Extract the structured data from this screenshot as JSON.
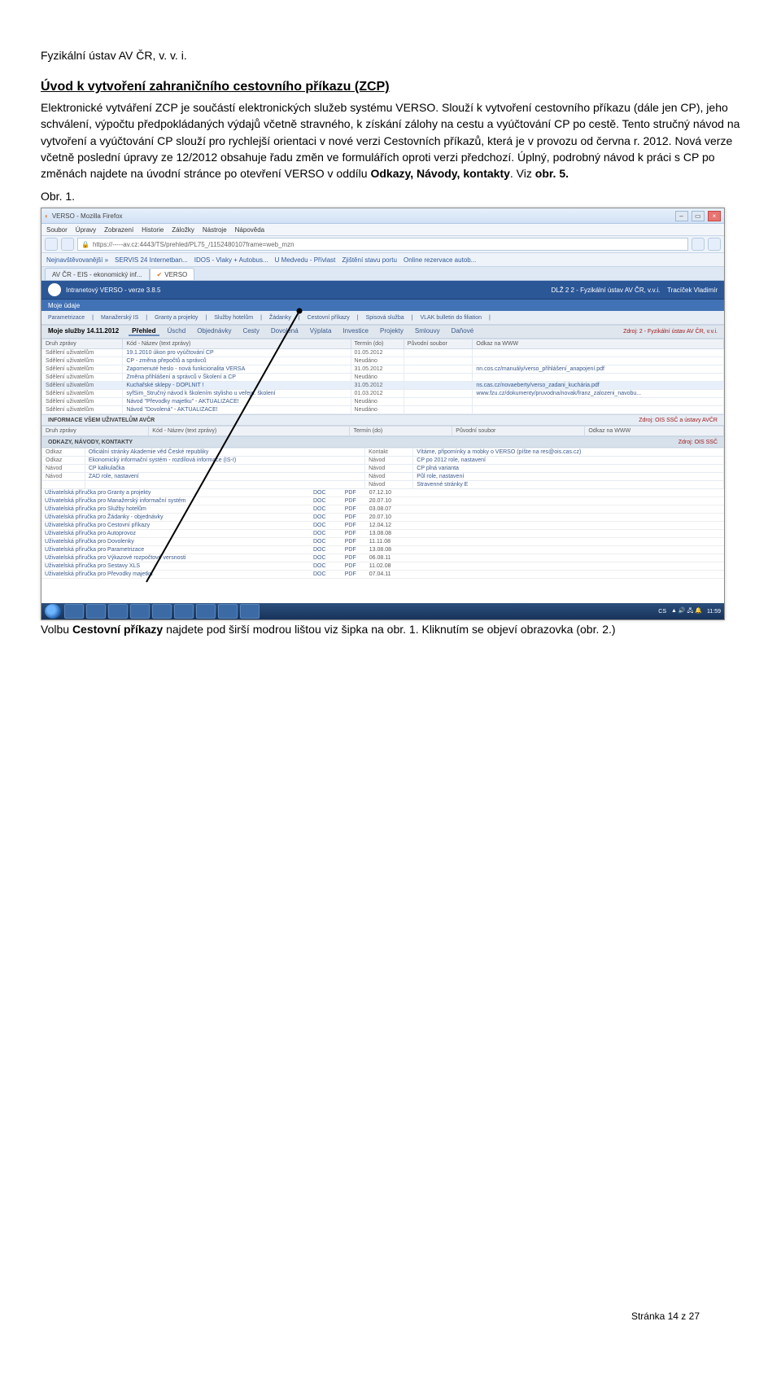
{
  "doc": {
    "header": "Fyzikální ústav AV ČR, v. v. i.",
    "title": "Úvod k vytvoření zahraničního cestovního příkazu (ZCP)",
    "p1a": "Elektronické vytváření ZCP je součástí elektronických služeb systému VERSO. Slouží k vytvoření cestovního příkazu (dále jen CP), jeho schválení, výpočtu předpokládaných výdajů včetně stravného, k získání zálohy na cestu a vyúčtování CP po cestě. Tento stručný návod na vytvoření a vyúčtování CP slouží pro rychlejší orientaci v nové verzi Cestovních příkazů, která je v provozu od června r. 2012. Nová verze včetně poslední úpravy ze 12/2012 obsahuje řadu změn ve formulářích oproti verzi předchozí. Úplný, podrobný návod k práci s CP po změnách najdete na úvodní stránce po otevření VERSO v oddílu ",
    "p1b": "Odkazy, Návody, kontakty",
    "p1c": ". Viz ",
    "p1d": "obr. 5.",
    "obr1": "Obr. 1.",
    "footer1a": "Volbu ",
    "footer1b": "Cestovní příkazy",
    "footer1c": " najdete pod širší modrou lištou viz šipka na obr. 1. Kliknutím se objeví obrazovka (obr. 2.)",
    "page_num": "Stránka 14 z 27"
  },
  "browser": {
    "window_title": "VERSO - Mozilla Firefox",
    "menu": [
      "Soubor",
      "Úpravy",
      "Zobrazení",
      "Historie",
      "Záložky",
      "Nástroje",
      "Nápověda"
    ],
    "url": "https://-----av.cz:4443/TS/prehled/PL75_/1152480107frame=web_mzn",
    "bookmarks": [
      "Nejnavštěvovanější »",
      "SERVIS 24 Internetban...",
      "IDOS - Vlaky + Autobus...",
      "U Medvedu - Přívlast",
      "Zjištění stavu portu",
      "Online rezervace autob..."
    ],
    "tab1": "AV ČR - EIS - ekonomický inf...",
    "tab2": "VERSO",
    "verso_title": "Intranetový VERSO - verze 3.8.5",
    "verso_right": "DLŽ 2 2 - Fyzikální ústav AV ČR, v.v.i.",
    "verso_user": "Tracíček Vladimír",
    "verso_sub": "Moje údaje",
    "menu_items": [
      "Parametrizace",
      "Manažerský IS",
      "Granty a projekty",
      "Služby hotelům",
      "Žádanky",
      "Cestovní příkazy",
      "Spisová služba",
      "VLAK bulletin do filiation"
    ],
    "sec1": {
      "label": "Moje služby 14.11.2012",
      "tabs": [
        "Přehled",
        "Úschd",
        "Objednávky",
        "Cesty",
        "Dovolená",
        "Výplata",
        "Investice",
        "Projekty",
        "Smlouvy",
        "Daňové"
      ],
      "right": "Zdroj: 2 - Fyzikální ústav AV ČR, v.v.i."
    },
    "tbl1": {
      "headers": [
        "Druh zprávy",
        "Kód - Název (text zprávy)",
        "Termín (do)",
        "Původní soubor",
        "Odkaz na WWW"
      ],
      "rows": [
        [
          "Sdělení uživatelům",
          "19.1.2010 úkon pro vyúčtování CP",
          "01.05.2012",
          "",
          ""
        ],
        [
          "Sdělení uživatelům",
          "CP - změna přepočtů a správců",
          "Neudáno",
          "",
          ""
        ],
        [
          "Sdělení uživatelům",
          "Zapomenuté heslo - nová funkcionalita VERSA",
          "31.05.2012",
          "",
          "nn.cos.cz/manuály/verso_přihlášení_anapojení.pdf"
        ],
        [
          "Sdělení uživatelům",
          "Změna přihlášení a správců v Školení a CP",
          "Neudáno",
          "",
          ""
        ],
        [
          "Sdělení uživatelům",
          "Kuchařské sklepy - DOPLNIT !",
          "31.05.2012",
          "",
          "ns.cas.cz/novaeberty/verso_zadani_kuchária.pdf"
        ],
        [
          "Sdělení uživatelům",
          "syfSim_Stručný návod k školením stylisho u veřejn. školení",
          "01.03.2012",
          "",
          "www.fzu.cz/dokumenty/pruvodna/novak/franz_zalozeni_navobu..."
        ],
        [
          "Sdělení uživatelům",
          "Návod \"Převodky majetku\" - AKTUALIZACE!",
          "Neudáno",
          "",
          ""
        ],
        [
          "Sdělení uživatelům",
          "Návod \"Dovolená\" - AKTUALIZACE!",
          "Neudáno",
          "",
          ""
        ]
      ]
    },
    "sec2": {
      "label": "INFORMACE VŠEM UŽIVATELŮM AVČR",
      "headers": [
        "Druh zprávy",
        "Kód - Název (text zprávy)",
        "Termín (do)",
        "Původní soubor",
        "Odkaz na WWW"
      ],
      "right": "Zdroj: OIS SSČ a ústavy AVČR"
    },
    "sec3": {
      "label": "ODKAZY, NÁVODY, KONTAKTY",
      "right": "Zdroj: OIS SSČ",
      "rows": [
        [
          "Odkaz",
          "Oficiální stránky Akademie věd České republiky",
          "Kontakt",
          "Vítáme, připomínky a mobky o VERSO  (píšte na res@ois.cas.cz)"
        ],
        [
          "Odkaz",
          "Ekonomický informační systém - rozdílová informace (IS-I)",
          "Návod",
          "CP po 2012 role, nastavení"
        ],
        [
          "Návod",
          "CP kalkulačka",
          "Návod",
          "CP plná varianta"
        ],
        [
          "Návod",
          "ZAD role, nastavení",
          "Návod",
          "Půl role, nastavení"
        ],
        [
          "",
          "",
          "Návod",
          "Stravenné stránky E"
        ]
      ]
    },
    "downloads": [
      [
        "Uživatelská příručka pro Granty a projekty",
        "DOC",
        "PDF",
        "07.12.10"
      ],
      [
        "Uživatelská příručka pro Manažerský informační systém",
        "DOC",
        "PDF",
        "20.07.10"
      ],
      [
        "Uživatelská příručka pro Služby hotelům",
        "DOC",
        "PDF",
        "03.08.07"
      ],
      [
        "Uživatelská příručka pro Žádanky - objednávky",
        "DOC",
        "PDF",
        "20.07.10"
      ],
      [
        "Uživatelská příručka pro Cestovní příkazy",
        "DOC",
        "PDF",
        "12.04.12"
      ],
      [
        "Uživatelská příručka pro Autoprovoz",
        "DOC",
        "PDF",
        "13.08.08"
      ],
      [
        "Uživatelská příručka pro Dovolenky",
        "DOC",
        "PDF",
        "11.11.08"
      ],
      [
        "Uživatelská příručka pro Parametrizace",
        "DOC",
        "PDF",
        "13.08.08"
      ],
      [
        "Uživatelská příručka pro Výkazové rozpočtové versnosti",
        "DOC",
        "PDF",
        "06.08.11"
      ],
      [
        "Uživatelská příručka pro Sestavy XLS",
        "DOC",
        "PDF",
        "11.02.08"
      ],
      [
        "Uživatelská příručka pro Převodky majetku",
        "DOC",
        "PDF",
        "07.04.11"
      ]
    ],
    "tray_time": "11:59"
  }
}
